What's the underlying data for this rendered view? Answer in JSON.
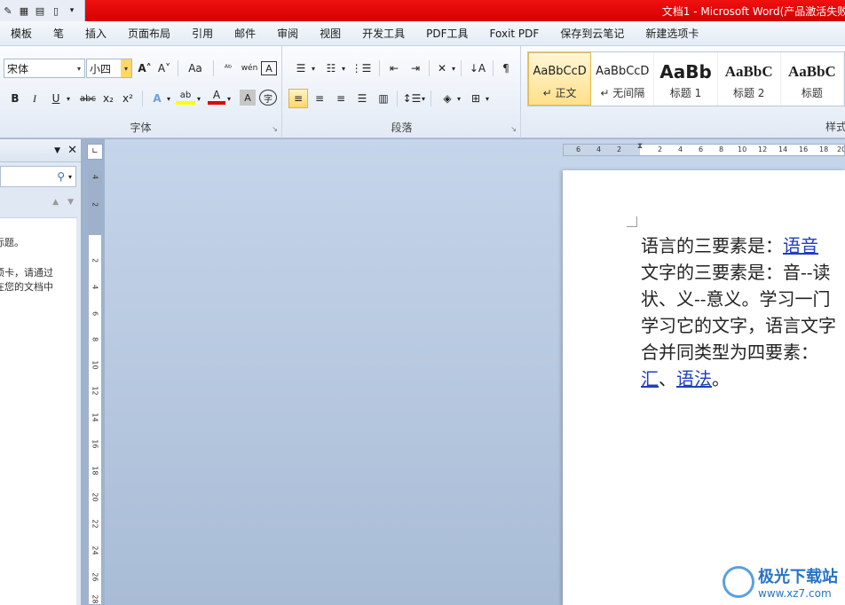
{
  "title": "文档1 - Microsoft Word(产品激活失败)",
  "qat_icons": [
    "pen-icon",
    "print-preview-icon",
    "format-icon",
    "reading-icon",
    "customize-qat-icon"
  ],
  "tabs": [
    "模板",
    "笔",
    "插入",
    "页面布局",
    "引用",
    "邮件",
    "审阅",
    "视图",
    "开发工具",
    "PDF工具",
    "Foxit PDF",
    "保存到云笔记",
    "新建选项卡"
  ],
  "ribbon": {
    "font": {
      "label": "字体",
      "font_name": "宋体",
      "font_size": "小四",
      "grow_font": "A˄",
      "shrink_font": "A˅",
      "change_case": "Aa",
      "pinyin": "wén",
      "bold": "B",
      "italic": "I",
      "underline": "U",
      "strikethrough": "abc",
      "subscript": "x₂",
      "superscript": "x²",
      "font_color_letter": "A",
      "highlight_color": "#ffff00",
      "font_color": "#e00000"
    },
    "paragraph": {
      "label": "段落"
    },
    "styles": {
      "label": "样式",
      "items": [
        {
          "preview": "AaBbCcD",
          "name": "↵ 正文",
          "selected": true
        },
        {
          "preview": "AaBbCcD",
          "name": "↵ 无间隔",
          "selected": false
        },
        {
          "preview": "AaBb",
          "name": "标题 1",
          "selected": false
        },
        {
          "preview": "AaBbC",
          "name": "标题 2",
          "selected": false
        },
        {
          "preview": "AaBbC",
          "name": "标题",
          "selected": false
        }
      ]
    }
  },
  "nav_pane": {
    "line1": "标题。",
    "line2": "项卡，请通过",
    "line3": "在您的文档中"
  },
  "hruler_ticks": [
    "6",
    "4",
    "2",
    "2",
    "4",
    "6",
    "8",
    "10",
    "12",
    "14",
    "16",
    "18",
    "20"
  ],
  "vruler_ticks": [
    "4",
    "2",
    "2",
    "4",
    "6",
    "8",
    "10",
    "12",
    "14",
    "16",
    "18",
    "20",
    "22",
    "24",
    "26",
    "28"
  ],
  "document": {
    "line1_text": "语言的三要素是：",
    "line1_link": "语音",
    "line2": "文字的三要素是：音--读",
    "line3": "状、义--意义。学习一门",
    "line4": "学习它的文字，语言文字",
    "line5": "合并同类型为四要素：",
    "line6_link1": "汇",
    "line6_sep": "、",
    "line6_link2": "语法",
    "line6_end": "。"
  },
  "watermark": {
    "brand": "极光下载站",
    "url": "www.xz7.com"
  }
}
